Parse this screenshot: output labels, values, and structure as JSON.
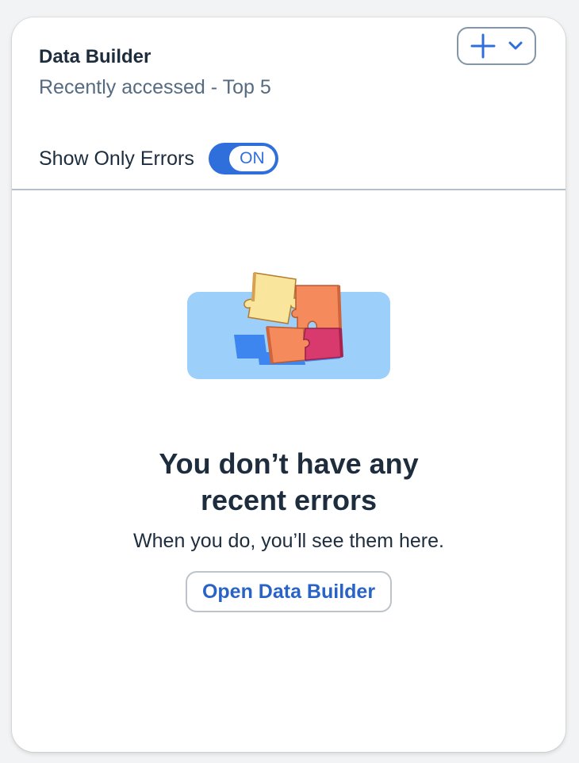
{
  "card": {
    "title": "Data Builder",
    "subtitle": "Recently accessed - Top 5",
    "add_menu": {
      "icons": [
        "plus-icon",
        "chevron-down-icon"
      ]
    },
    "filter": {
      "label": "Show Only Errors",
      "toggle_state": "ON",
      "enabled": true
    }
  },
  "empty_state": {
    "illustration": "puzzle-pieces-illustration",
    "title_line1": "You don’t have any",
    "title_line2": "recent errors",
    "description": "When you do, you’ll see them here.",
    "action_label": "Open Data Builder"
  },
  "colors": {
    "accent": "#2f6fdc",
    "title_text": "#1d2d3e",
    "secondary_text": "#556b82",
    "illustration_bg": "#9ccffa"
  }
}
